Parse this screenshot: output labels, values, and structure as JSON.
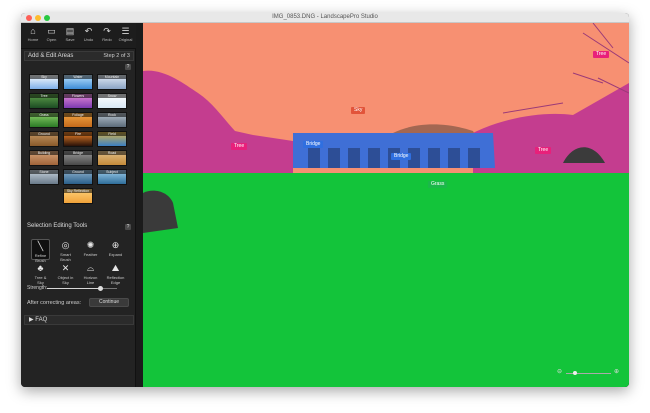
{
  "window": {
    "title": "IMG_0853.DNG - LandscapePro Studio"
  },
  "toolbar": {
    "items": [
      {
        "label": "Home",
        "icon": "home-icon",
        "glyph": "⌂"
      },
      {
        "label": "Open",
        "icon": "open-icon",
        "glyph": "▭"
      },
      {
        "label": "Save",
        "icon": "save-icon",
        "glyph": "▤"
      },
      {
        "label": "Undo",
        "icon": "undo-icon",
        "glyph": "↶"
      },
      {
        "label": "Redo",
        "icon": "redo-icon",
        "glyph": "↷"
      },
      {
        "label": "Original",
        "icon": "layers-icon",
        "glyph": "☰"
      }
    ]
  },
  "sidebar": {
    "section_title": "Add & Edit Areas",
    "step": "Step 2 of 3",
    "help": "?",
    "area_tiles": [
      {
        "label": "Sky",
        "colors": [
          "#7fb0ea",
          "#ffffff"
        ]
      },
      {
        "label": "Water",
        "colors": [
          "#3d8bd6",
          "#bfe4ff"
        ]
      },
      {
        "label": "Mountain",
        "colors": [
          "#8aa3c4",
          "#e5edf7"
        ]
      },
      {
        "label": "Tree",
        "colors": [
          "#1c4c23",
          "#5fa04b"
        ]
      },
      {
        "label": "Flowers",
        "colors": [
          "#7c3ab0",
          "#e48ad6"
        ]
      },
      {
        "label": "Snow",
        "colors": [
          "#d9e8f5",
          "#ffffff"
        ]
      },
      {
        "label": "Grass",
        "colors": [
          "#2b7a26",
          "#8fd26b"
        ]
      },
      {
        "label": "Foliage",
        "colors": [
          "#c46a1b",
          "#f2a543"
        ]
      },
      {
        "label": "Rock",
        "colors": [
          "#5c6b7a",
          "#b8c4cf"
        ]
      },
      {
        "label": "Ground",
        "colors": [
          "#8a5a2b",
          "#c89a64"
        ]
      },
      {
        "label": "Fire",
        "colors": [
          "#2a1208",
          "#f2852a"
        ]
      },
      {
        "label": "Field",
        "colors": [
          "#3b7fc2",
          "#d9b44a"
        ]
      },
      {
        "label": "Building",
        "colors": [
          "#a0643a",
          "#d7a57a"
        ]
      },
      {
        "label": "Bridge",
        "colors": [
          "#4a4a4a",
          "#9a9a9a"
        ]
      },
      {
        "label": "Road",
        "colors": [
          "#c48a3a",
          "#e2c089"
        ]
      },
      {
        "label": "Stone",
        "colors": [
          "#6a7a8a",
          "#c8d4de"
        ]
      },
      {
        "label": "Ground",
        "colors": [
          "#2a5f8a",
          "#8fb3cf"
        ]
      },
      {
        "label": "Subject",
        "colors": [
          "#2f6d9a",
          "#9fd0ee"
        ]
      },
      {
        "label": "Sky Reflection",
        "colors": [
          "#f0a23a",
          "#ffd27a"
        ]
      }
    ],
    "tools_title": "Selection Editing Tools",
    "tools": [
      {
        "label": "Refine Brush",
        "icon": "brush-icon",
        "glyph": "╲",
        "active": true
      },
      {
        "label": "Smart Brush",
        "icon": "smart-brush-icon",
        "glyph": "◎"
      },
      {
        "label": "Feather",
        "icon": "feather-icon",
        "glyph": "✺"
      },
      {
        "label": "Expand",
        "icon": "expand-icon",
        "glyph": "⊕"
      },
      {
        "label": "Tree & Sky",
        "icon": "tree-sky-icon",
        "glyph": "♣"
      },
      {
        "label": "Object in Sky",
        "icon": "object-sky-icon",
        "glyph": "✕"
      },
      {
        "label": "Horizon Line",
        "icon": "horizon-icon",
        "glyph": "⌓"
      },
      {
        "label": "Reflection Edge",
        "icon": "reflection-icon",
        "glyph": "⛰"
      }
    ],
    "strength_label": "Strength:",
    "strength_value": 0.75,
    "after_label": "After correcting areas:",
    "continue_label": "Continue",
    "faq_label": "▶ FAQ"
  },
  "canvas": {
    "tags": [
      {
        "label": "Sky",
        "color": "#e2543a"
      },
      {
        "label": "Tree",
        "color": "#e8207a"
      },
      {
        "label": "Bridge",
        "color": "#2f6fe0"
      },
      {
        "label": "Bridge",
        "color": "#2f6fe0"
      },
      {
        "label": "Tree",
        "color": "#e8207a"
      },
      {
        "label": "Tree",
        "color": "#e8207a"
      },
      {
        "label": "Grass",
        "color": "#1bb84a"
      }
    ],
    "zoom_value": 0.2
  },
  "colors": {
    "sky_mask": "#f79072",
    "tree_mask": "#c43d8f",
    "grass_mask": "#13c43a",
    "bridge_mask": "#3f6fd6"
  }
}
